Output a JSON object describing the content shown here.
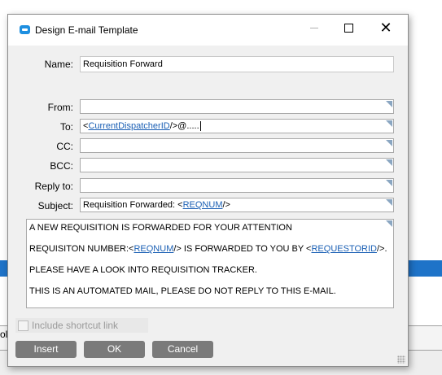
{
  "window": {
    "title": "Design E-mail Template",
    "controls": {
      "minimize": "minimize",
      "maximize": "maximize",
      "close": "close"
    }
  },
  "form": {
    "name_label": "Name:",
    "name_value": "Requisition Forward",
    "from_label": "From:",
    "from_value": "",
    "to_label": "To:",
    "to_prefix": "<",
    "to_link": "CurrentDispatcherID",
    "to_suffix": "/>@.....",
    "cc_label": "CC:",
    "cc_value": "",
    "bcc_label": "BCC:",
    "bcc_value": "",
    "replyto_label": "Reply to:",
    "replyto_value": "",
    "subject_label": "Subject:",
    "subject_prefix": "Requisition Forwarded: <",
    "subject_link": "REQNUM",
    "subject_suffix": "/>"
  },
  "body": {
    "line1": "A NEW REQUISITION IS FORWARDED FOR YOUR ATTENTION",
    "line2_prefix": "REQUISITON NUMBER:<",
    "line2_link1": "REQNUM",
    "line2_middle": "/> IS FORWARDED TO YOU BY <",
    "line2_link2": "REQUESTORID",
    "line2_suffix": "/>.",
    "line3": "PLEASE HAVE A LOOK INTO REQUISITION TRACKER.",
    "line4": "THIS IS AN AUTOMATED MAIL, PLEASE DO NOT REPLY TO THIS E-MAIL."
  },
  "options": {
    "include_shortcut_label": "Include shortcut link",
    "include_shortcut_checked": false,
    "include_shortcut_enabled": false
  },
  "buttons": {
    "insert": "Insert",
    "ok": "OK",
    "cancel": "Cancel"
  },
  "background": {
    "partial_text": "ola"
  },
  "colors": {
    "accent_blue": "#1e73c8",
    "link": "#1a5fb4",
    "button_gray": "#7a7a7a"
  }
}
